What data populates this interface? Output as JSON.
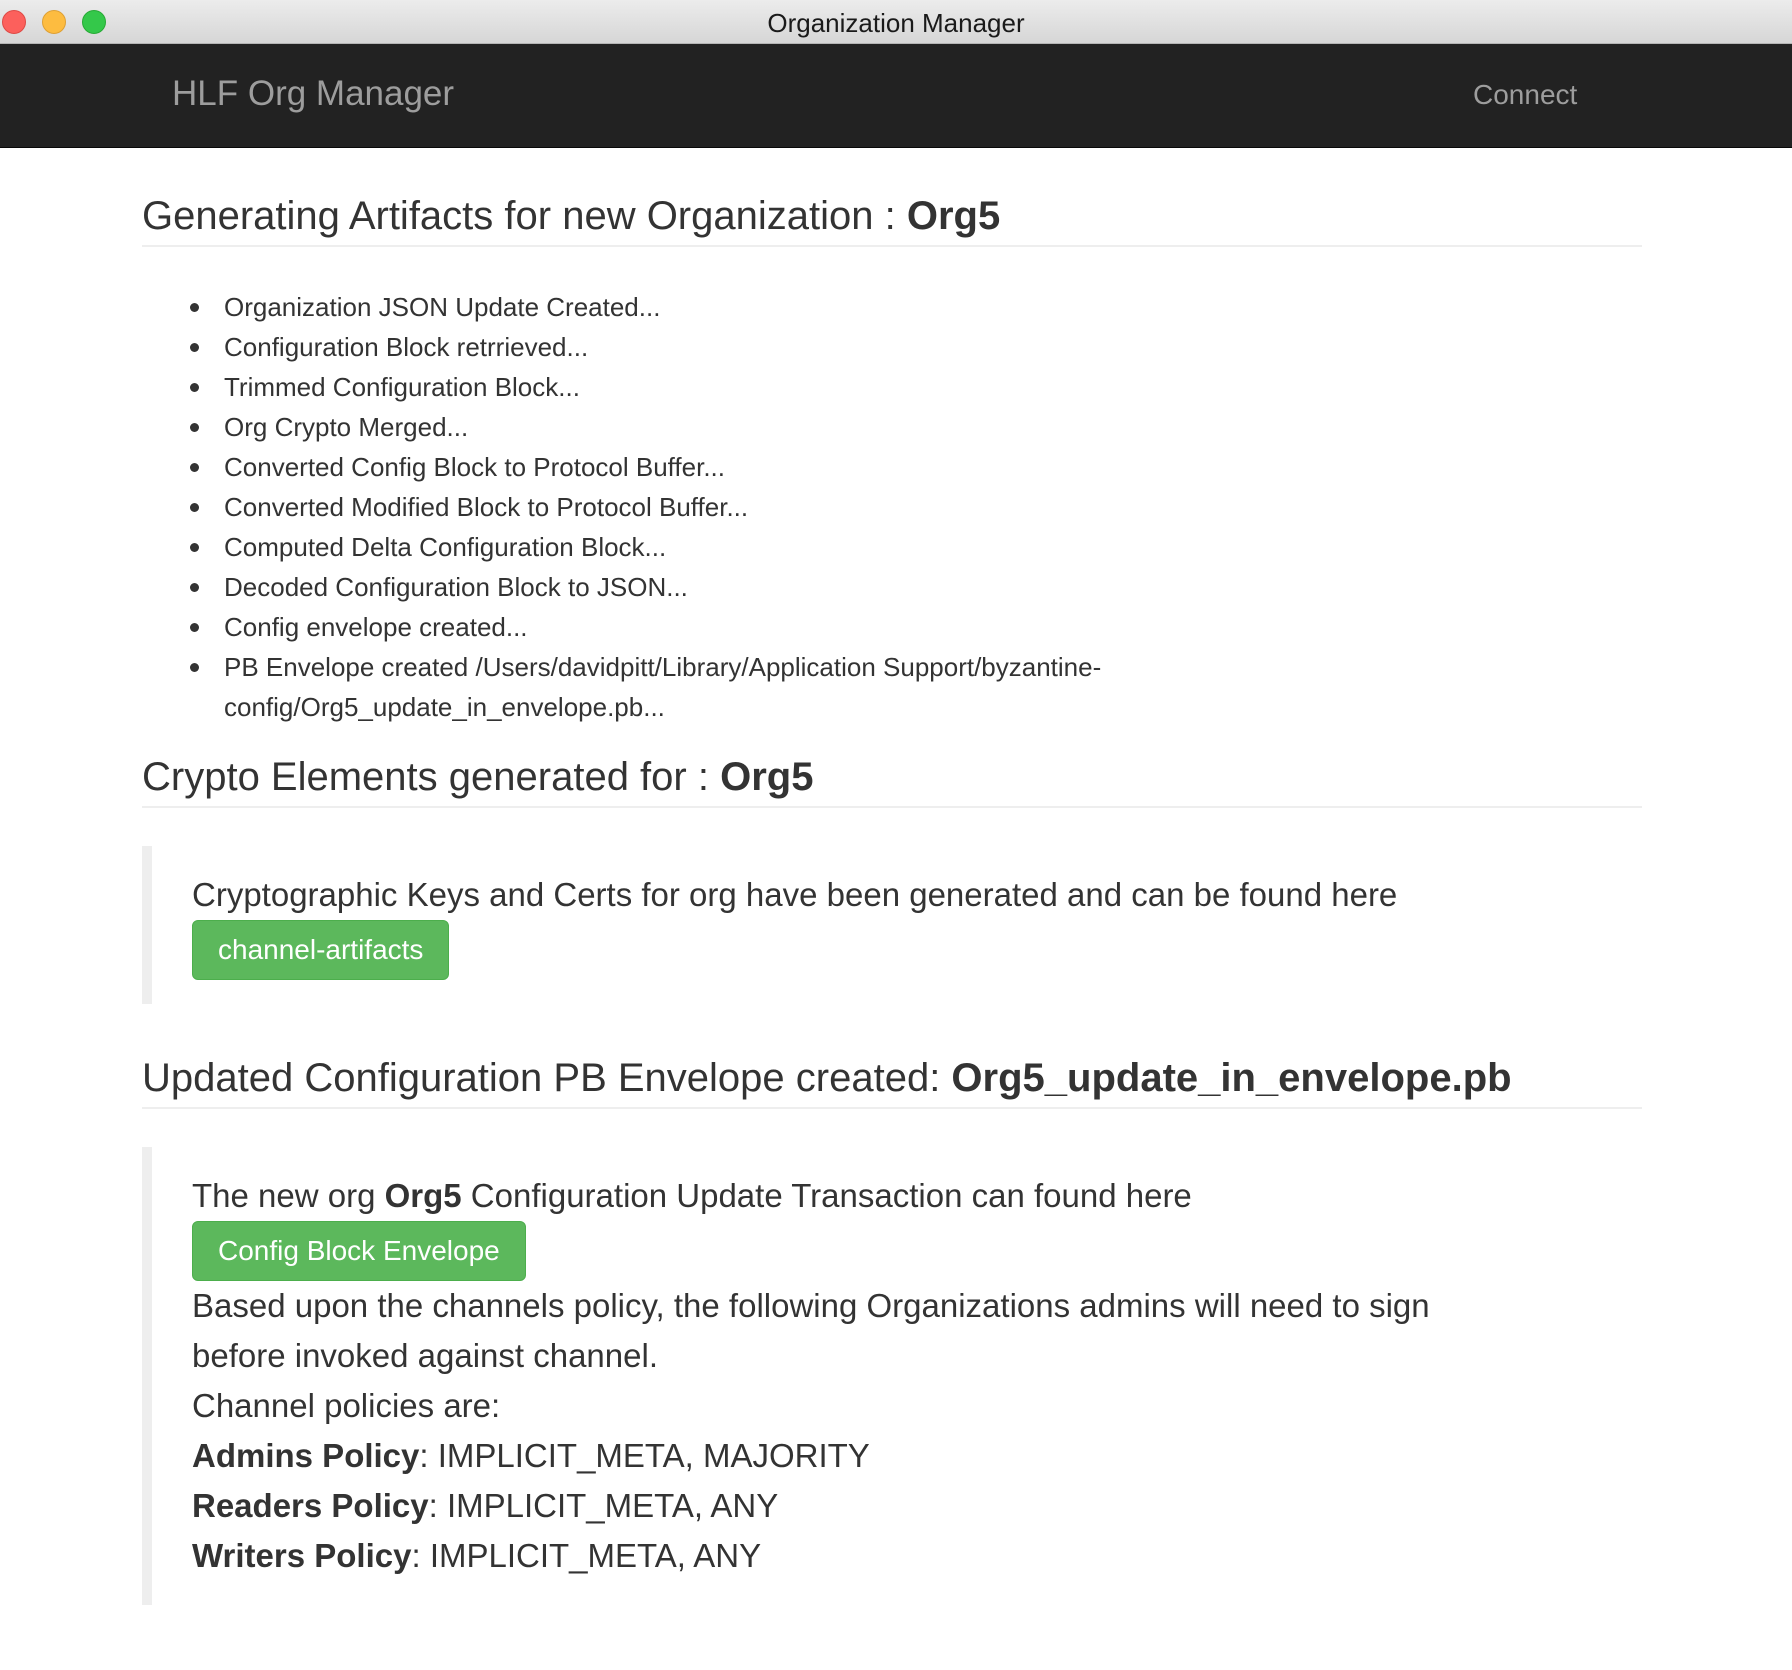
{
  "window": {
    "title": "Organization Manager"
  },
  "navbar": {
    "brand": "HLF Org Manager",
    "connect": "Connect"
  },
  "artifacts": {
    "heading_prefix": "Generating Artifacts for new Organization : ",
    "org_name": "Org5",
    "steps": [
      "Organization JSON Update Created...",
      "Configuration Block retrrieved...",
      "Trimmed Configuration Block...",
      "Org Crypto Merged...",
      "Converted Config Block to Protocol Buffer...",
      "Converted Modified Block to Protocol Buffer...",
      "Computed Delta Configuration Block...",
      "Decoded Configuration Block to JSON...",
      "Config envelope created...",
      "PB Envelope created /Users/davidpitt/Library/Application Support/byzantine-config/Org5_update_in_envelope.pb..."
    ]
  },
  "crypto": {
    "heading_prefix": "Crypto Elements generated for : ",
    "org_name": "Org5",
    "message": "Cryptographic Keys and Certs for org have been generated and can be found here",
    "button_label": "channel-artifacts"
  },
  "config": {
    "heading_prefix": "Updated Configuration PB Envelope created: ",
    "file_name": "Org5_update_in_envelope.pb",
    "msg_prefix": "The new org ",
    "msg_org": "Org5",
    "msg_suffix": " Configuration Update Transaction can found here",
    "button_label": "Config Block Envelope",
    "sign_text_1": "Based upon the channels policy, the following Organizations admins will need to sign",
    "sign_text_2": "before invoked against channel.",
    "policies_intro": "Channel policies are:",
    "policies": [
      {
        "name": "Admins Policy",
        "value": ": IMPLICIT_META, MAJORITY"
      },
      {
        "name": "Readers Policy",
        "value": ": IMPLICIT_META, ANY"
      },
      {
        "name": "Writers Policy",
        "value": ": IMPLICIT_META, ANY"
      }
    ]
  }
}
